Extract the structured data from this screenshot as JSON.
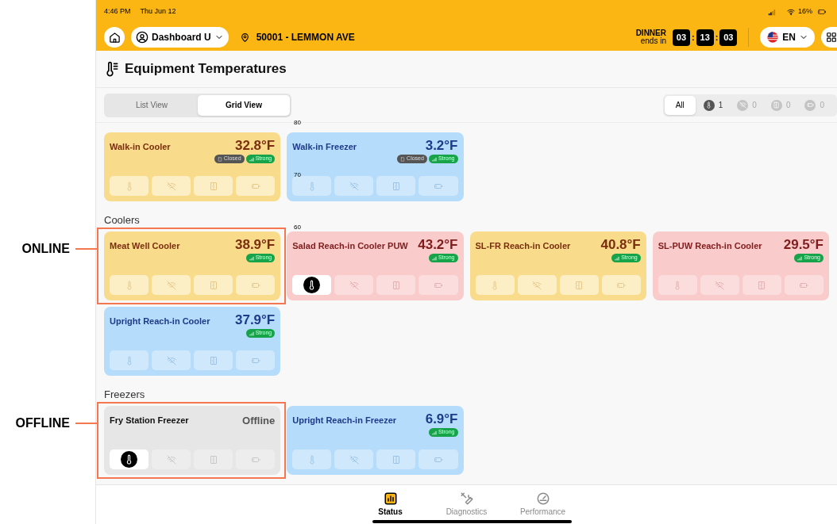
{
  "status_bar": {
    "time": "4:46 PM",
    "date": "Thu Jun 12",
    "battery": "16%"
  },
  "header": {
    "dashboard": "Dashboard U",
    "location": "50001 - LEMMON AVE",
    "meal": "DINNER",
    "ends_in": "ends in",
    "timer": [
      "03",
      ":",
      "13",
      ":",
      "03"
    ],
    "language": "EN"
  },
  "page_title": "Equipment Temperatures",
  "view_tabs": [
    {
      "label": "List View",
      "selected": false
    },
    {
      "label": "Grid View",
      "selected": true
    }
  ],
  "filters": [
    {
      "kind": "all",
      "label": "All",
      "selected": true
    },
    {
      "kind": "thermometer",
      "count": "1",
      "selected": false,
      "highlighted": true
    },
    {
      "kind": "wifi-off",
      "count": "0",
      "selected": false,
      "highlighted": false
    },
    {
      "kind": "door",
      "count": "0",
      "selected": false,
      "highlighted": false
    },
    {
      "kind": "battery",
      "count": "0",
      "selected": false,
      "highlighted": false
    }
  ],
  "sections": [
    {
      "cards": [
        {
          "name": "Walk-in Cooler",
          "reading": "32.8°F",
          "kind": "warning",
          "door": "Closed",
          "signal": "Strong",
          "thermometer_alert": false
        },
        {
          "name": "Walk-in Freezer",
          "reading": "3.2°F",
          "kind": "normal",
          "door": "Closed",
          "signal": "Strong",
          "thermometer_alert": false
        }
      ]
    },
    {
      "title": "Coolers",
      "cards": [
        {
          "name": "Meat Well Cooler",
          "reading": "38.9°F",
          "kind": "warning",
          "signal": "Strong",
          "thermometer_alert": false,
          "annotation": "ONLINE"
        },
        {
          "name": "Salad Reach-in Cooler PUW",
          "reading": "43.2°F",
          "kind": "alert",
          "signal": "Strong",
          "thermometer_alert": true
        },
        {
          "name": "SL-FR Reach-in Cooler",
          "reading": "40.8°F",
          "kind": "warning",
          "signal": "Strong",
          "thermometer_alert": false
        },
        {
          "name": "SL-PUW Reach-in Cooler",
          "reading": "29.5°F",
          "kind": "alert",
          "signal": "Strong",
          "thermometer_alert": false
        },
        {
          "name": "Upright Reach-in Cooler",
          "reading": "37.9°F",
          "kind": "normal",
          "signal": "Strong",
          "thermometer_alert": false
        }
      ]
    },
    {
      "title": "Freezers",
      "cards": [
        {
          "name": "Fry Station Freezer",
          "reading": "Offline",
          "kind": "offline",
          "thermometer_alert": true,
          "annotation": "OFFLINE"
        },
        {
          "name": "Upright Reach-in Freezer",
          "reading": "6.9°F",
          "kind": "normal",
          "signal": "Strong",
          "thermometer_alert": false
        }
      ]
    }
  ],
  "axis_labels": [
    "80",
    "70",
    "60"
  ],
  "bottom_nav": [
    {
      "label": "Status",
      "kind": "status",
      "selected": true
    },
    {
      "label": "Diagnostics",
      "kind": "diagnostics",
      "selected": false
    },
    {
      "label": "Performance",
      "kind": "performance",
      "selected": false
    }
  ]
}
